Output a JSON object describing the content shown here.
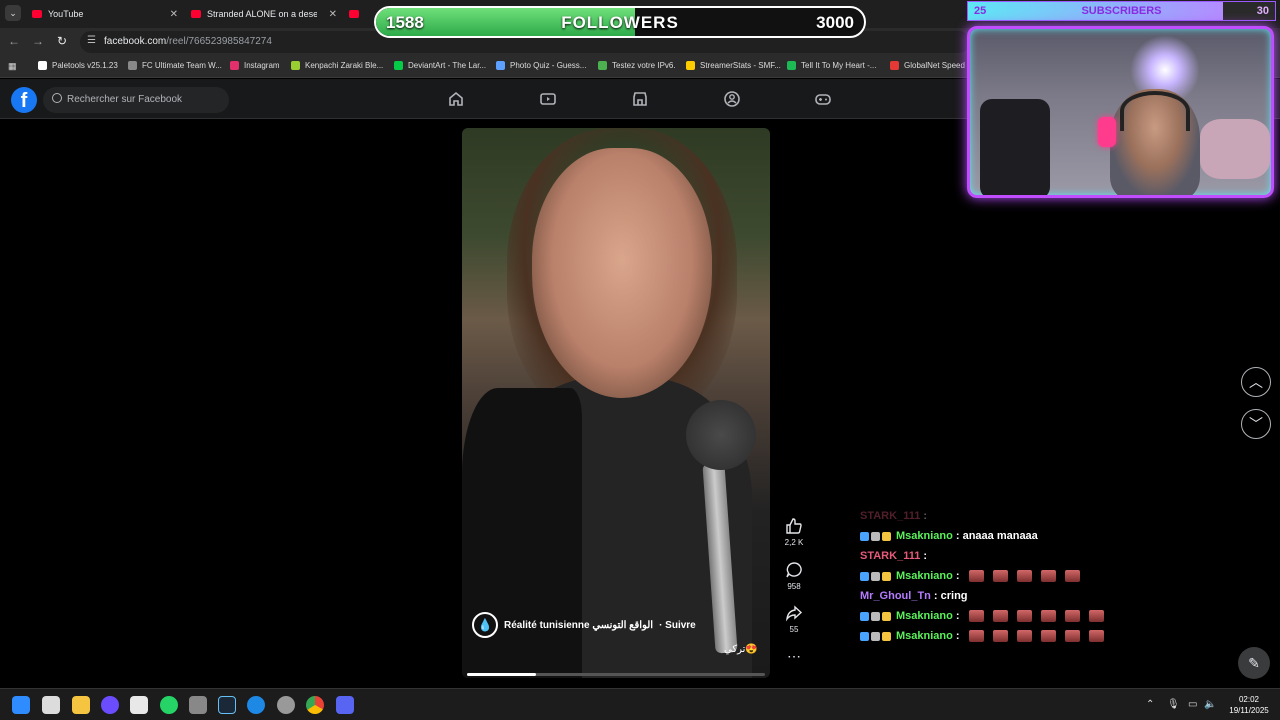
{
  "browser": {
    "tabs": [
      {
        "title": "YouTube"
      },
      {
        "title": "Stranded ALONE on a deserted"
      },
      {
        "title": ""
      }
    ],
    "url_domain": "facebook.com",
    "url_path": "/reel/766523985847274",
    "bookmarks": [
      {
        "label": "Paletools v25.1.23",
        "color": "#ffffff"
      },
      {
        "label": "FC Ultimate Team W...",
        "color": "#888888"
      },
      {
        "label": "Instagram",
        "color": "#e1306c"
      },
      {
        "label": "Kenpachi Zaraki Ble...",
        "color": "#9acd32"
      },
      {
        "label": "DeviantArt - The Lar...",
        "color": "#05cc47"
      },
      {
        "label": "Photo Quiz - Guess...",
        "color": "#5ea0ff"
      },
      {
        "label": "Testez votre IPv6.",
        "color": "#4caf50"
      },
      {
        "label": "StreamerStats - SMF...",
        "color": "#ffcc00"
      },
      {
        "label": "Tell It To My Heart -...",
        "color": "#1db954"
      },
      {
        "label": "GlobalNet Speed",
        "color": "#e53935"
      }
    ]
  },
  "facebook": {
    "logo": "f",
    "search_placeholder": "Rechercher sur Facebook",
    "nav_icons": [
      "home-icon",
      "video-icon",
      "marketplace-icon",
      "groups-icon",
      "gaming-icon"
    ]
  },
  "reel": {
    "author": "Réalité tunisienne الواقع التونسي",
    "follow_label": "· Suivre",
    "caption": "تركي😍",
    "progress": 0.23,
    "likes": "2,2 K",
    "comments": "958",
    "shares": "55"
  },
  "overlay": {
    "followers_current": "1588",
    "followers_label": "FOLLOWERS",
    "followers_goal": "3000",
    "followers_progress": 0.53,
    "subs_current": "25",
    "subs_label": "SUBSCRIBERS",
    "subs_goal": "30",
    "subs_progress": 0.83
  },
  "chat": [
    {
      "user": "STARK_111",
      "text": ":",
      "color": "#e85a7a",
      "badges": false,
      "emotes": 0,
      "faded": true
    },
    {
      "user": "Msakniano",
      "text": ": anaaa manaaa",
      "color": "#5cf05c",
      "badges": true,
      "emotes": 0,
      "faded": false
    },
    {
      "user": "STARK_111",
      "text": ":",
      "color": "#e85a7a",
      "badges": false,
      "emotes": 0,
      "faded": false
    },
    {
      "user": "Msakniano",
      "text": ":",
      "color": "#5cf05c",
      "badges": true,
      "emotes": 5,
      "faded": false
    },
    {
      "user": "Mr_Ghoul_Tn",
      "text": ": cring",
      "color": "#b57cff",
      "badges": false,
      "emotes": 0,
      "faded": false
    },
    {
      "user": "Msakniano",
      "text": ":",
      "color": "#5cf05c",
      "badges": true,
      "emotes": 6,
      "faded": false
    },
    {
      "user": "Msakniano",
      "text": ":",
      "color": "#5cf05c",
      "badges": true,
      "emotes": 6,
      "faded": false
    }
  ],
  "taskbar": {
    "time": "02:02",
    "date": "19/11/2025"
  }
}
